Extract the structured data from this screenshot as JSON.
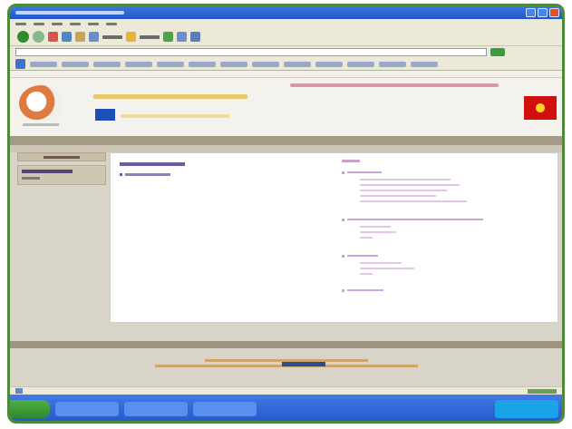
{
  "window": {
    "title": ""
  },
  "menu": {
    "items": [
      "",
      "",
      "",
      "",
      "",
      ""
    ]
  },
  "address": {
    "url": ""
  },
  "page": {
    "header": {
      "tagline": "",
      "eu_text": "",
      "top_links": ""
    },
    "sidebar": {
      "tab_label": "",
      "item_label": "",
      "item_meta": ""
    },
    "content": {
      "left_title": "",
      "left_items": [
        ""
      ],
      "right_head": "",
      "groups": [
        {
          "label": "",
          "lines": [
            "",
            "",
            "",
            "",
            ""
          ]
        },
        {
          "label": "",
          "lines": [
            "",
            "",
            ""
          ]
        },
        {
          "label": "",
          "lines": [
            "",
            "",
            ""
          ]
        },
        {
          "label": "",
          "lines": []
        }
      ]
    },
    "footer": {
      "line1": "",
      "line2": ""
    }
  },
  "taskbar": {
    "start_label": "",
    "tasks": [
      "",
      "",
      ""
    ]
  },
  "colors": {
    "titlebar": "#2a66d8",
    "accent_band": "#a69a84",
    "link_purple": "#6b5aa6",
    "link_pink": "#e2c6ea",
    "footer_text": "#d0a56a",
    "taskbar": "#2f66d6"
  },
  "icons": [
    "back-icon",
    "forward-icon",
    "stop-icon",
    "refresh-icon",
    "home-icon",
    "search-icon",
    "favorites-icon",
    "history-icon",
    "mail-icon",
    "print-icon",
    "ie-logo-icon",
    "eu-flag-icon",
    "macedonian-flag-icon"
  ]
}
